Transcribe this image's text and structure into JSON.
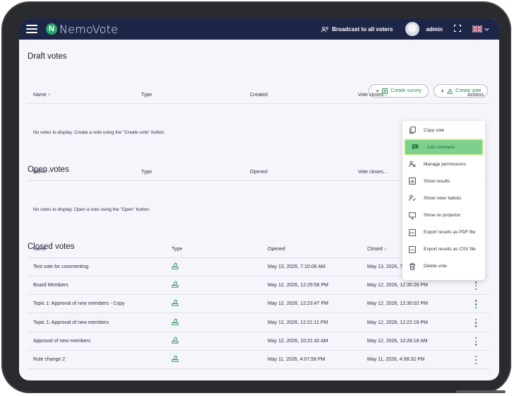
{
  "header": {
    "logo_text": "NemoVote",
    "broadcast_label": "Broadcast to all voters",
    "user_name": "admin",
    "icons": {
      "menu": "hamburger-icon",
      "broadcast": "broadcast-icon",
      "fullscreen": "fullscreen-icon",
      "language": "uk-flag-icon"
    }
  },
  "draft": {
    "title": "Draft votes",
    "create_survey_label": "Create survey",
    "create_vote_label": "Create vote",
    "columns": {
      "name": "Name",
      "type": "Type",
      "created": "Created",
      "vote_closes": "Vote closes...",
      "actions": "Actions"
    },
    "empty_message": "No votes to display. Create a vote using the \"Create vote\" button."
  },
  "open": {
    "title": "Open votes",
    "columns": {
      "name": "Name",
      "type": "Type",
      "opened": "Opened",
      "vote_closes": "Vote closes..."
    },
    "empty_message": "No votes to display. Open a vote using the \"Open\" button."
  },
  "closed": {
    "title": "Closed votes",
    "columns": {
      "name": "Name",
      "type": "Type",
      "opened": "Opened",
      "closed": "Closed"
    },
    "rows": [
      {
        "name": "Test vote for commenting",
        "opened": "May 13, 2026, 7:10:06 AM",
        "closed": "May 13, 2026, 7:10:18 AM"
      },
      {
        "name": "Board Members",
        "opened": "May 12, 2026, 12:29:56 PM",
        "closed": "May 12, 2026, 12:30:28 PM"
      },
      {
        "name": "Topic 1: Approval of new members - Copy",
        "opened": "May 12, 2026, 12:23:47 PM",
        "closed": "May 12, 2026, 12:30:02 PM"
      },
      {
        "name": "Topic 1: Approval of new members",
        "opened": "May 12, 2026, 12:21:11 PM",
        "closed": "May 12, 2026, 12:22:18 PM"
      },
      {
        "name": "Approval of new members",
        "opened": "May 12, 2026, 10:21:42 AM",
        "closed": "May 12, 2026, 10:28:18 AM"
      },
      {
        "name": "Rule change 2",
        "opened": "May 11, 2026, 4:07:58 PM",
        "closed": "May 11, 2026, 4:08:32 PM"
      }
    ]
  },
  "menu": {
    "items": [
      {
        "label": "Copy vote",
        "icon": "copy-icon"
      },
      {
        "label": "Add comment",
        "icon": "comment-icon",
        "active": true
      },
      {
        "label": "Manage permissions",
        "icon": "permissions-icon"
      },
      {
        "label": "Show results",
        "icon": "results-icon"
      },
      {
        "label": "Show voter ballots",
        "icon": "ballots-icon"
      },
      {
        "label": "Show on projector",
        "icon": "projector-icon"
      },
      {
        "label": "Export results as PDF file",
        "icon": "pdf-icon"
      },
      {
        "label": "Export results as CSV file",
        "icon": "csv-icon"
      },
      {
        "label": "Delete vote",
        "icon": "trash-icon"
      }
    ]
  },
  "colors": {
    "topbar": "#1e2648",
    "accent": "#1f8d4f",
    "active_menu": "#7fd08e",
    "logo": "#28a96b"
  }
}
